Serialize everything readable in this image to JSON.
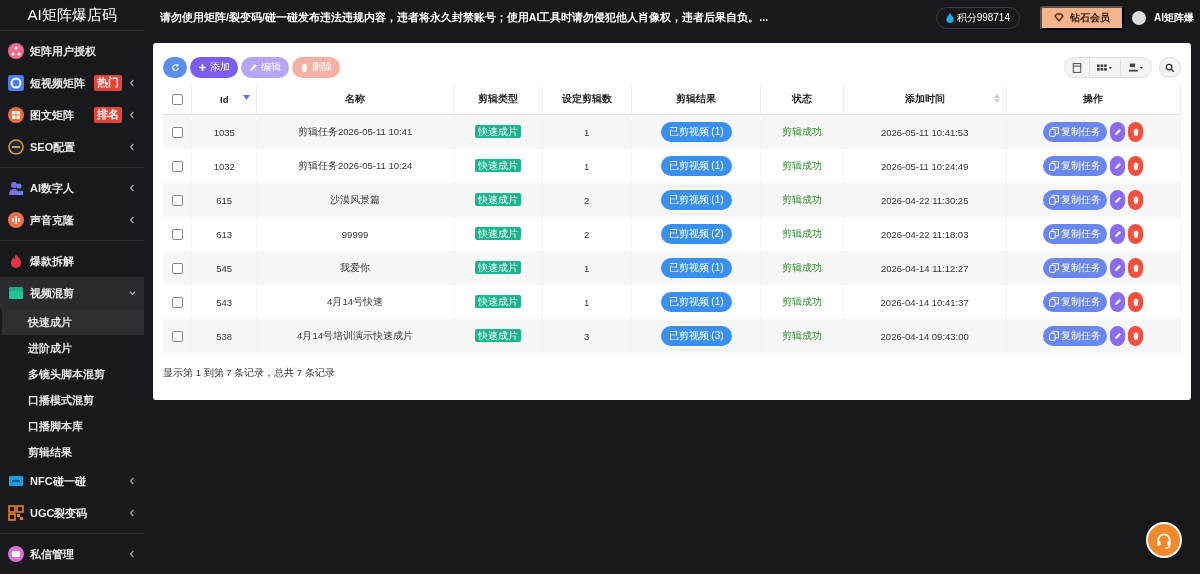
{
  "brand": "AI矩阵爆店码",
  "notice": "请勿使用矩阵/裂变码/碰一碰发布违法违规内容，违者将永久封禁账号；使用AI工具时请勿侵犯他人肖像权，违者后果自负。...",
  "points": "积分998714",
  "membership": "钻石会员",
  "user": "AI矩阵爆",
  "sidebar": {
    "groups": [
      [
        {
          "label": "矩阵用户授权",
          "has_arrow": false,
          "expanded": false
        },
        {
          "label": "短视频矩阵",
          "badge": "热门",
          "has_arrow": true,
          "expanded": false
        },
        {
          "label": "图文矩阵",
          "badge": "排名",
          "has_arrow": true,
          "expanded": false
        },
        {
          "label": "SEO配置",
          "has_arrow": true,
          "expanded": false
        }
      ],
      [
        {
          "label": "AI数字人",
          "has_arrow": true,
          "expanded": false
        },
        {
          "label": "声音克隆",
          "has_arrow": true,
          "expanded": false
        }
      ],
      [
        {
          "label": "爆款拆解",
          "has_arrow": false,
          "expanded": false
        },
        {
          "label": "视频混剪",
          "has_arrow": true,
          "expanded": true,
          "children": [
            {
              "label": "快速成片",
              "selected": true
            },
            {
              "label": "进阶成片",
              "selected": false
            },
            {
              "label": "多镜头脚本混剪",
              "selected": false
            },
            {
              "label": "口播模式混剪",
              "selected": false
            },
            {
              "label": "口播脚本库",
              "selected": false
            },
            {
              "label": "剪辑结果",
              "selected": false
            }
          ]
        },
        {
          "label": "NFC碰一碰",
          "has_arrow": true,
          "expanded": false
        },
        {
          "label": "UGC裂变码",
          "has_arrow": true,
          "expanded": false
        }
      ],
      [
        {
          "label": "私信管理",
          "has_arrow": true,
          "expanded": false
        }
      ]
    ]
  },
  "toolbar": [
    {
      "kind": "refresh",
      "disabled": false
    },
    {
      "kind": "add",
      "label": "添加",
      "disabled": false
    },
    {
      "kind": "edit",
      "label": "编辑",
      "disabled": true
    },
    {
      "kind": "delete",
      "label": "删除",
      "disabled": true
    }
  ],
  "table": {
    "columns": [
      {
        "label": "Id",
        "sortable": true,
        "sorted": true
      },
      {
        "label": "名称"
      },
      {
        "label": "剪辑类型"
      },
      {
        "label": "设定剪辑数"
      },
      {
        "label": "剪辑结果"
      },
      {
        "label": "状态"
      },
      {
        "label": "添加时间",
        "sortable": true,
        "sorted": false
      },
      {
        "label": "操作"
      }
    ],
    "header_checked": false,
    "rows": [
      {
        "checked": false,
        "id": "1035",
        "name": "剪辑任务2026-05-11 10:41",
        "type": "快速成片",
        "count": "1",
        "result": "已剪视频 (1)",
        "status": "剪辑成功",
        "time": "2026-05-11 10:41:53",
        "action": "复制任务"
      },
      {
        "checked": false,
        "id": "1032",
        "name": "剪辑任务2026-05-11 10:24",
        "type": "快速成片",
        "count": "1",
        "result": "已剪视频 (1)",
        "status": "剪辑成功",
        "time": "2026-05-11 10:24:49",
        "action": "复制任务"
      },
      {
        "checked": false,
        "id": "615",
        "name": "沙漠风景篇",
        "type": "快速成片",
        "count": "2",
        "result": "已剪视频 (1)",
        "status": "剪辑成功",
        "time": "2026-04-22 11:30:25",
        "action": "复制任务"
      },
      {
        "checked": false,
        "id": "613",
        "name": "99999",
        "type": "快速成片",
        "count": "2",
        "result": "已剪视频 (2)",
        "status": "剪辑成功",
        "time": "2026-04-22 11:18:03",
        "action": "复制任务"
      },
      {
        "checked": false,
        "id": "545",
        "name": "我爱你",
        "type": "快速成片",
        "count": "1",
        "result": "已剪视频 (1)",
        "status": "剪辑成功",
        "time": "2026-04-14 11:12:27",
        "action": "复制任务"
      },
      {
        "checked": false,
        "id": "543",
        "name": "4月14号快速",
        "type": "快速成片",
        "count": "1",
        "result": "已剪视频 (1)",
        "status": "剪辑成功",
        "time": "2026-04-14 10:41:37",
        "action": "复制任务"
      },
      {
        "checked": false,
        "id": "538",
        "name": "4月14号培训演示快速成片",
        "type": "快速成片",
        "count": "3",
        "result": "已剪视频 (3)",
        "status": "剪辑成功",
        "time": "2026-04-14 09:43:00",
        "action": "复制任务"
      }
    ]
  },
  "pagination": "显示第 1 到第 7 条记录，总共 7 条记录"
}
